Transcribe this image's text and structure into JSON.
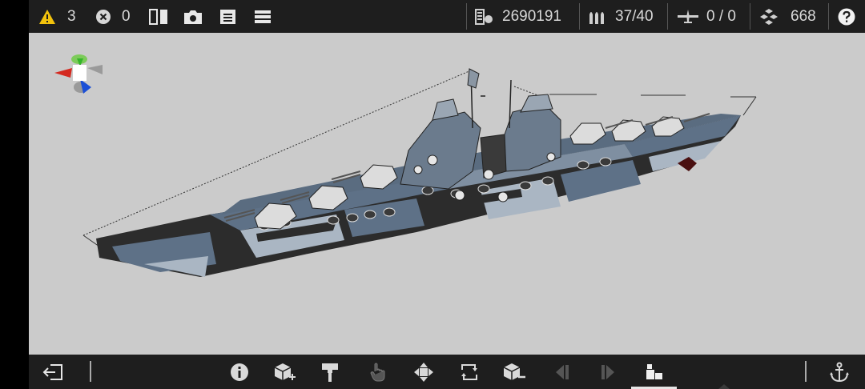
{
  "topbar": {
    "warnings": {
      "icon": "warning-icon",
      "count": "3"
    },
    "errors": {
      "icon": "error-icon",
      "count": "0"
    },
    "buttons": [
      "mirror-icon",
      "camera-icon",
      "save-icon",
      "menu-icon"
    ],
    "stats": [
      {
        "icon": "weight-icon",
        "value": "2690191"
      },
      {
        "icon": "ammo-icon",
        "value": "37/40"
      },
      {
        "icon": "aircraft-icon",
        "value": "0 / 0"
      },
      {
        "icon": "parts-icon",
        "value": "668"
      }
    ],
    "help_icon": "help-icon"
  },
  "viewport": {
    "gizmo": "orientation-gizmo-icon",
    "model": "battleship-model"
  },
  "bottombar": {
    "buttons": [
      {
        "icon": "exit-icon"
      },
      {
        "icon": "info-icon"
      },
      {
        "icon": "add-part-icon"
      },
      {
        "icon": "paint-icon"
      },
      {
        "icon": "select-hand-icon"
      },
      {
        "icon": "move-icon"
      },
      {
        "icon": "rotate-icon"
      },
      {
        "icon": "remove-part-icon"
      },
      {
        "icon": "prev-icon"
      },
      {
        "icon": "next-icon"
      },
      {
        "icon": "assembly-icon",
        "active": true
      },
      {
        "icon": "anchor-icon"
      }
    ]
  },
  "colors": {
    "bar_bg": "#1e1e1e",
    "viewport_bg": "#cbcbcb",
    "warning": "#f2c20c",
    "hull_dark": "#2c2c2c",
    "hull_blue": "#5e7187",
    "hull_light": "#aab6c3"
  }
}
